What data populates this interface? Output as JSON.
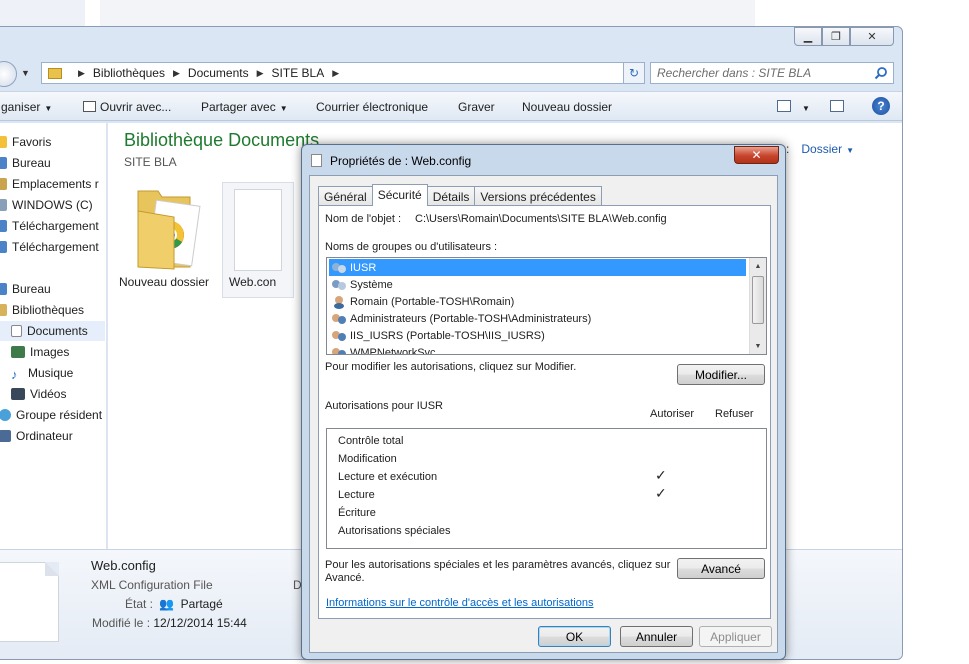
{
  "window": {
    "address": {
      "crumbs": [
        "Bibliothèques",
        "Documents",
        "SITE BLA"
      ]
    },
    "search": {
      "placeholder": "Rechercher dans : SITE BLA"
    },
    "toolbar": {
      "organize": "ganiser",
      "open_with": "Ouvrir avec...",
      "share": "Partager avec",
      "email": "Courrier électronique",
      "burn": "Graver",
      "new_folder": "Nouveau dossier"
    },
    "nav": {
      "favorites": "Favoris",
      "items": [
        "Bureau",
        "Emplacements r",
        "WINDOWS (C)",
        "Téléchargement",
        "Téléchargement"
      ],
      "desktop": "Bureau",
      "libraries": "Bibliothèques",
      "lib_items": [
        "Documents",
        "Images",
        "Musique",
        "Vidéos"
      ],
      "homegroup": "Groupe résident",
      "computer": "Ordinateur"
    },
    "content": {
      "title": "Bibliothèque Documents",
      "subtitle": "SITE BLA",
      "arrange_label": "s:",
      "arrange_value": "Dossier",
      "files": [
        "Nouveau dossier",
        "Web.con"
      ]
    },
    "details": {
      "name": "Web.config",
      "type": "XML Configuration File",
      "state_label": "État :",
      "state_value": "Partagé",
      "modified_label": "Modifié le :",
      "modified_value": "12/12/2014 15:44",
      "extra": "D"
    }
  },
  "dialog": {
    "title": "Propriétés de : Web.config",
    "tabs": [
      "Général",
      "Sécurité",
      "Détails",
      "Versions précédentes"
    ],
    "object_label": "Nom de l'objet :",
    "object_path": "C:\\Users\\Romain\\Documents\\SITE BLA\\Web.config",
    "groups_label": "Noms de groupes ou d'utilisateurs :",
    "users": [
      "IUSR",
      "Système",
      "Romain (Portable-TOSH\\Romain)",
      "Administrateurs (Portable-TOSH\\Administrateurs)",
      "IIS_IUSRS (Portable-TOSH\\IIS_IUSRS)",
      "WMPNetworkSvc"
    ],
    "modify_hint": "Pour modifier les autorisations, cliquez sur Modifier.",
    "modify_button": "Modifier...",
    "permissions_for": "Autorisations pour IUSR",
    "allow_col": "Autoriser",
    "deny_col": "Refuser",
    "permissions": [
      {
        "name": "Contrôle total",
        "allow": false
      },
      {
        "name": "Modification",
        "allow": false
      },
      {
        "name": "Lecture et exécution",
        "allow": true
      },
      {
        "name": "Lecture",
        "allow": true
      },
      {
        "name": "Écriture",
        "allow": false
      },
      {
        "name": "Autorisations spéciales",
        "allow": false
      }
    ],
    "check_glyph": "✓",
    "advanced_hint_1": "Pour les autorisations spéciales et les paramètres avancés, cliquez sur",
    "advanced_hint_2": "Avancé.",
    "advanced_button": "Avancé",
    "link": "Informations sur le contrôle d'accès et les autorisations",
    "ok": "OK",
    "cancel": "Annuler",
    "apply": "Appliquer"
  }
}
